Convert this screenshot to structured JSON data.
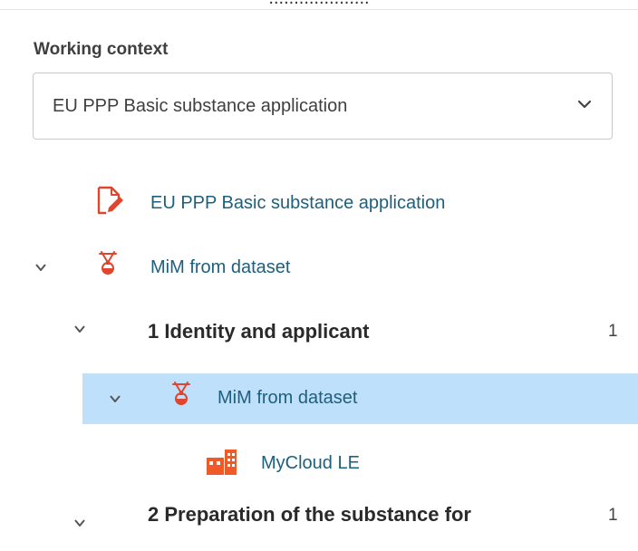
{
  "header": {
    "clipped_title": "...................."
  },
  "context": {
    "label": "Working context",
    "selected": "EU PPP Basic substance application"
  },
  "tree": {
    "dossier": {
      "label": "EU PPP Basic substance application",
      "icon": "edit-document-icon"
    },
    "mim_root": {
      "label": "MiM from dataset",
      "icon": "mixture-flask-icon"
    },
    "section1": {
      "label": "1 Identity and applicant",
      "count": "1"
    },
    "mim_child": {
      "label": "MiM from dataset",
      "icon": "mixture-flask-icon"
    },
    "entity": {
      "label": "MyCloud LE",
      "icon": "legal-entity-building-icon"
    },
    "section2": {
      "label": "2 Preparation of the substance for",
      "count": "1"
    }
  },
  "colors": {
    "link": "#1d5f7d",
    "selected_bg": "#bfe0fb",
    "icon_accent": "#e0462f",
    "entity_orange": "#f05a28"
  }
}
